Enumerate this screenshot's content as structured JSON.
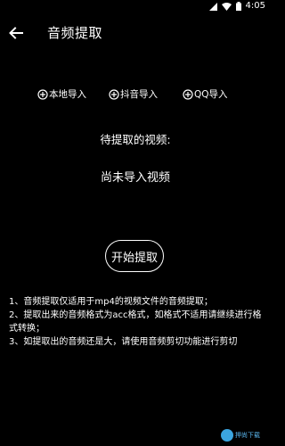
{
  "status_bar": {
    "time": "4:05"
  },
  "app_bar": {
    "title": "音频提取"
  },
  "import_options": [
    {
      "label": "本地导入",
      "icon": "plus-circle-icon"
    },
    {
      "label": "抖音导入",
      "icon": "plus-circle-icon"
    },
    {
      "label": "QQ导入",
      "icon": "plus-circle-icon"
    }
  ],
  "main": {
    "pending_label": "待提取的视频:",
    "empty_status": "尚未导入视频",
    "start_button": "开始提取"
  },
  "notes": [
    "1、音频提取仅适用于mp4的视频文件的音频提取；",
    "2、提取出来的音频格式为acc格式，如格式不适用请继续进行格式转换；",
    "3、如提取出的音频还是大，请使用音频剪切功能进行剪切"
  ],
  "watermark": {
    "text": "押尚下载"
  },
  "colors": {
    "background": "#000000",
    "foreground": "#ffffff"
  }
}
